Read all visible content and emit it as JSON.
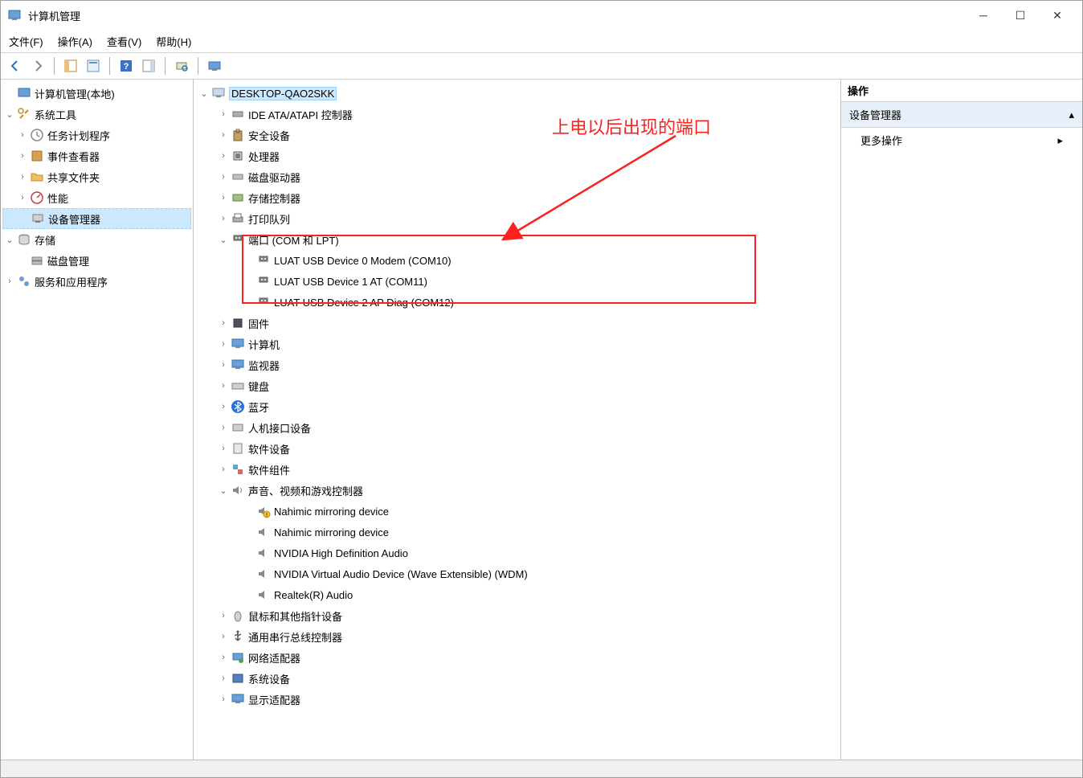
{
  "window": {
    "title": "计算机管理"
  },
  "menu": {
    "file": "文件(F)",
    "action": "操作(A)",
    "view": "查看(V)",
    "help": "帮助(H)"
  },
  "leftTree": {
    "root": "计算机管理(本地)",
    "systemTools": "系统工具",
    "taskScheduler": "任务计划程序",
    "eventViewer": "事件查看器",
    "sharedFolders": "共享文件夹",
    "performance": "性能",
    "deviceManager": "设备管理器",
    "storage": "存储",
    "diskManagement": "磁盘管理",
    "servicesApps": "服务和应用程序"
  },
  "centerTree": {
    "root": "DESKTOP-QAO2SKK",
    "ide": "IDE ATA/ATAPI 控制器",
    "security": "安全设备",
    "processor": "处理器",
    "diskDrives": "磁盘驱动器",
    "storageControllers": "存储控制器",
    "printQueue": "打印队列",
    "ports": "端口 (COM 和 LPT)",
    "port0": "LUAT USB Device 0 Modem (COM10)",
    "port1": "LUAT USB Device 1 AT (COM11)",
    "port2": "LUAT USB Device 2 AP Diag (COM12)",
    "firmware": "固件",
    "computer": "计算机",
    "monitor": "监视器",
    "keyboard": "键盘",
    "bluetooth": "蓝牙",
    "hid": "人机接口设备",
    "softwareDevices": "软件设备",
    "softwareComponents": "软件组件",
    "sound": "声音、视频和游戏控制器",
    "soundItem0": "Nahimic mirroring device",
    "soundItem1": "Nahimic mirroring device",
    "soundItem2": "NVIDIA High Definition Audio",
    "soundItem3": "NVIDIA Virtual Audio Device (Wave Extensible) (WDM)",
    "soundItem4": "Realtek(R) Audio",
    "mouse": "鼠标和其他指针设备",
    "usb": "通用串行总线控制器",
    "network": "网络适配器",
    "systemDevices": "系统设备",
    "display": "显示适配器"
  },
  "actions": {
    "header": "操作",
    "deviceManager": "设备管理器",
    "more": "更多操作"
  },
  "annotation": "上电以后出现的端口"
}
